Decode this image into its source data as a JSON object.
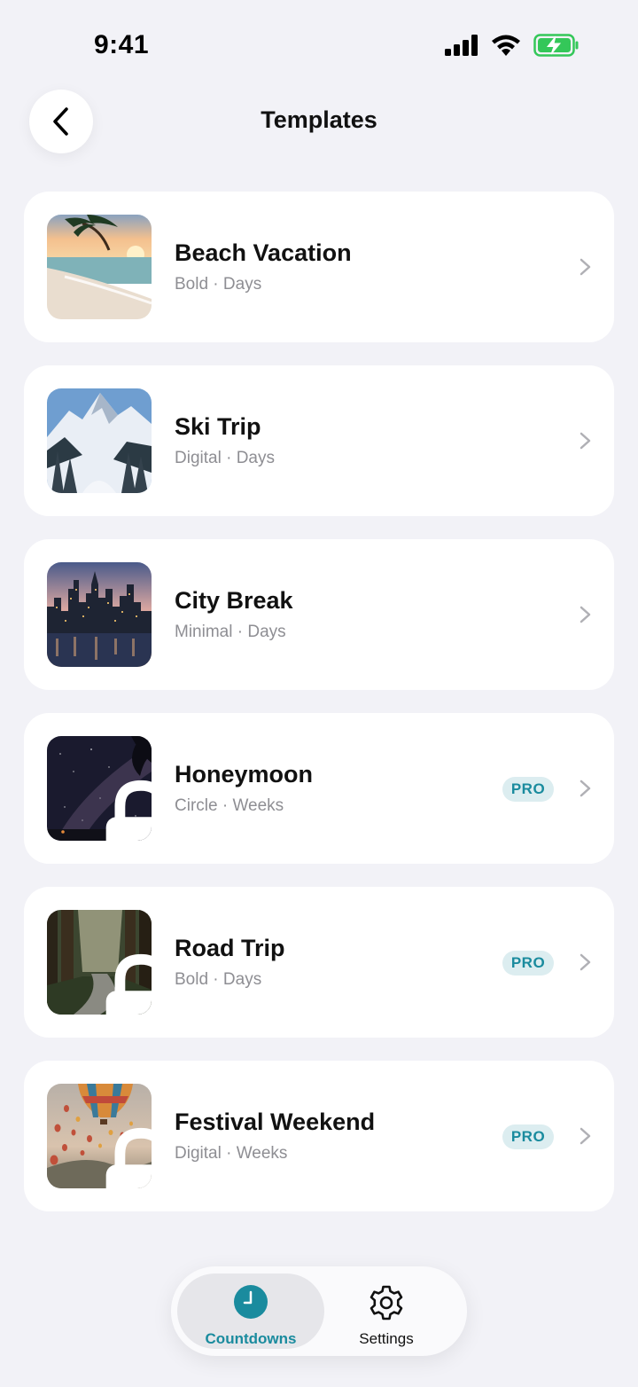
{
  "status_bar": {
    "time": "9:41"
  },
  "header": {
    "title": "Templates"
  },
  "templates": [
    {
      "title": "Beach Vacation",
      "style": "Bold",
      "unit": "Days",
      "pro": false,
      "locked": false,
      "thumbnail": "beach-palm-sunset"
    },
    {
      "title": "Ski Trip",
      "style": "Digital",
      "unit": "Days",
      "pro": false,
      "locked": false,
      "thumbnail": "snowy-mountains"
    },
    {
      "title": "City Break",
      "style": "Minimal",
      "unit": "Days",
      "pro": false,
      "locked": false,
      "thumbnail": "city-skyline-dusk"
    },
    {
      "title": "Honeymoon",
      "style": "Circle",
      "unit": "Weeks",
      "pro": true,
      "locked": true,
      "thumbnail": "milky-way-night"
    },
    {
      "title": "Road Trip",
      "style": "Bold",
      "unit": "Days",
      "pro": true,
      "locked": true,
      "thumbnail": "forest-road"
    },
    {
      "title": "Festival Weekend",
      "style": "Digital",
      "unit": "Weeks",
      "pro": true,
      "locked": true,
      "thumbnail": "hot-air-balloons"
    }
  ],
  "pro_badge_label": "PRO",
  "separator": " · ",
  "tab_bar": {
    "tabs": [
      {
        "label": "Countdowns",
        "icon": "clock-icon",
        "active": true
      },
      {
        "label": "Settings",
        "icon": "gear-icon",
        "active": false
      }
    ]
  },
  "colors": {
    "background": "#f2f2f7",
    "accent": "#1a8b9e",
    "pro_badge_bg": "#dcedf0",
    "subtitle": "#8e8e93",
    "battery": "#34c759"
  }
}
